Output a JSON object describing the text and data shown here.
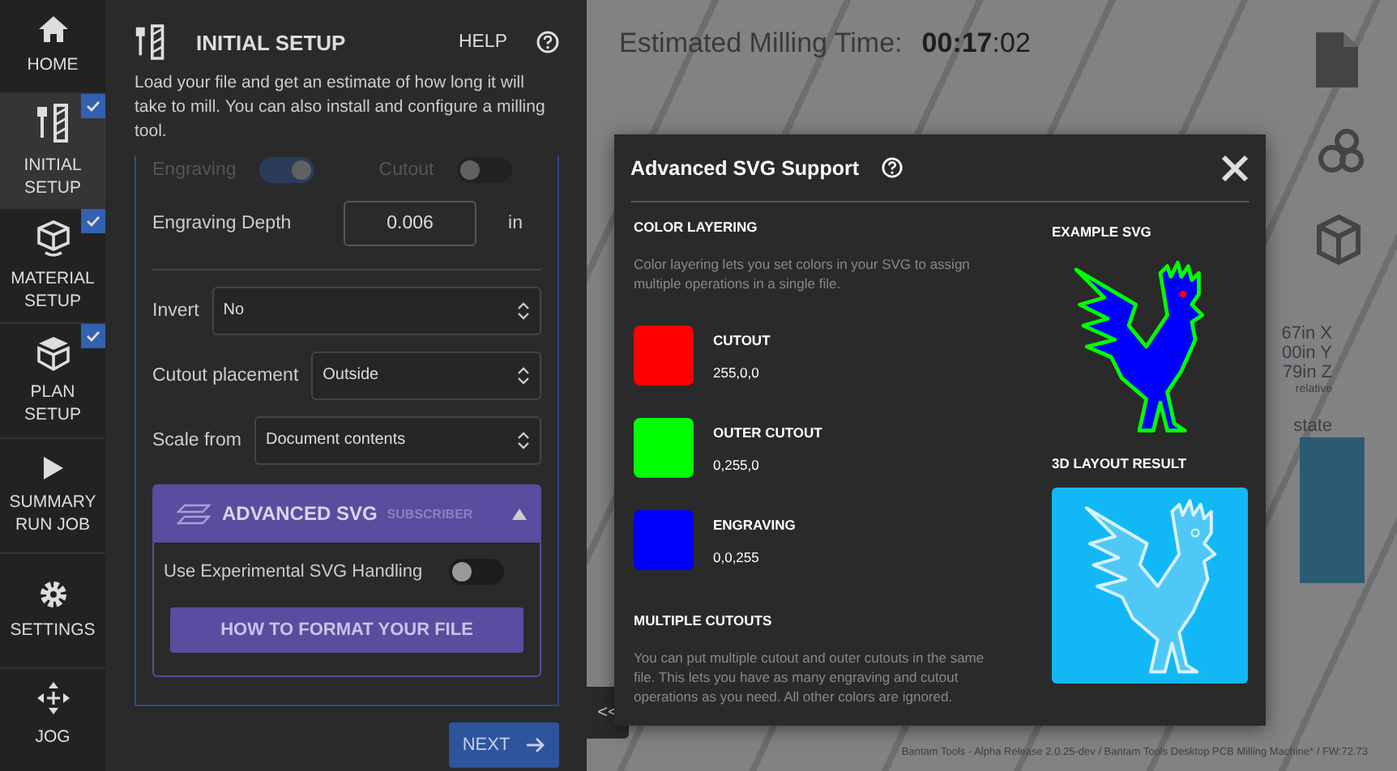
{
  "sidebar": {
    "items": [
      {
        "label": "HOME",
        "selected": false,
        "checked": false
      },
      {
        "label": "INITIAL SETUP",
        "selected": true,
        "checked": true
      },
      {
        "label": "MATERIAL SETUP",
        "selected": false,
        "checked": true
      },
      {
        "label": "PLAN SETUP",
        "selected": false,
        "checked": true
      },
      {
        "label": "SUMMARY RUN JOB",
        "selected": false,
        "checked": false
      },
      {
        "label": "SETTINGS",
        "selected": false,
        "checked": false
      },
      {
        "label": "JOG",
        "selected": false,
        "checked": false
      }
    ]
  },
  "panel": {
    "title": "INITIAL SETUP",
    "help": "HELP",
    "description": "Load your file and get an estimate of how long it will take to mill. You can also install and configure a milling tool.",
    "toggles": [
      {
        "label": "Engraving",
        "on": true
      },
      {
        "label": "Cutout",
        "on": false
      }
    ],
    "depth": {
      "label": "Engraving Depth",
      "value": "0.006",
      "unit": "in"
    },
    "selects": [
      {
        "label": "Invert",
        "value": "No"
      },
      {
        "label": "Cutout placement",
        "value": "Outside"
      },
      {
        "label": "Scale from",
        "value": "Document contents"
      }
    ],
    "advanced": {
      "title": "ADVANCED SVG",
      "badge": "SUBSCRIBER",
      "expanded": true,
      "toggle": {
        "label": "Use Experimental SVG Handling",
        "on": false
      },
      "button": "HOW TO FORMAT YOUR FILE"
    },
    "next": "NEXT",
    "collapse": "<<"
  },
  "estimate": {
    "label": "Estimated Milling Time:",
    "value": "**00:17**:02"
  },
  "readouts": [
    "67in X",
    "00in Y",
    "79in Z",
    "relative",
    "state"
  ],
  "footer": "Bantam Tools - Alpha Release 2.0.25-dev / Bantam Tools Desktop PCB Milling Machine* / FW:72.73",
  "modal": {
    "title": "Advanced SVG Support",
    "sections": [
      {
        "heading": "COLOR LAYERING",
        "text": "Color layering lets you set colors in your SVG to assign multiple operations in a single file.",
        "swatches": [
          {
            "name": "CUTOUT",
            "rgb": "255,0,0",
            "color": "#ff0000"
          },
          {
            "name": "OUTER CUTOUT",
            "rgb": "0,255,0",
            "color": "#00ff00"
          },
          {
            "name": "ENGRAVING",
            "rgb": "0,0,255",
            "color": "#0000ff"
          }
        ]
      },
      {
        "heading": "MULTIPLE CUTOUTS",
        "text": "You can put multiple cutout and outer cutouts in the same file. This lets you have as many engraving and cutout operations as you need. All other colors are ignored."
      }
    ],
    "example_heading": "EXAMPLE SVG",
    "result_heading": "3D LAYOUT RESULT"
  }
}
